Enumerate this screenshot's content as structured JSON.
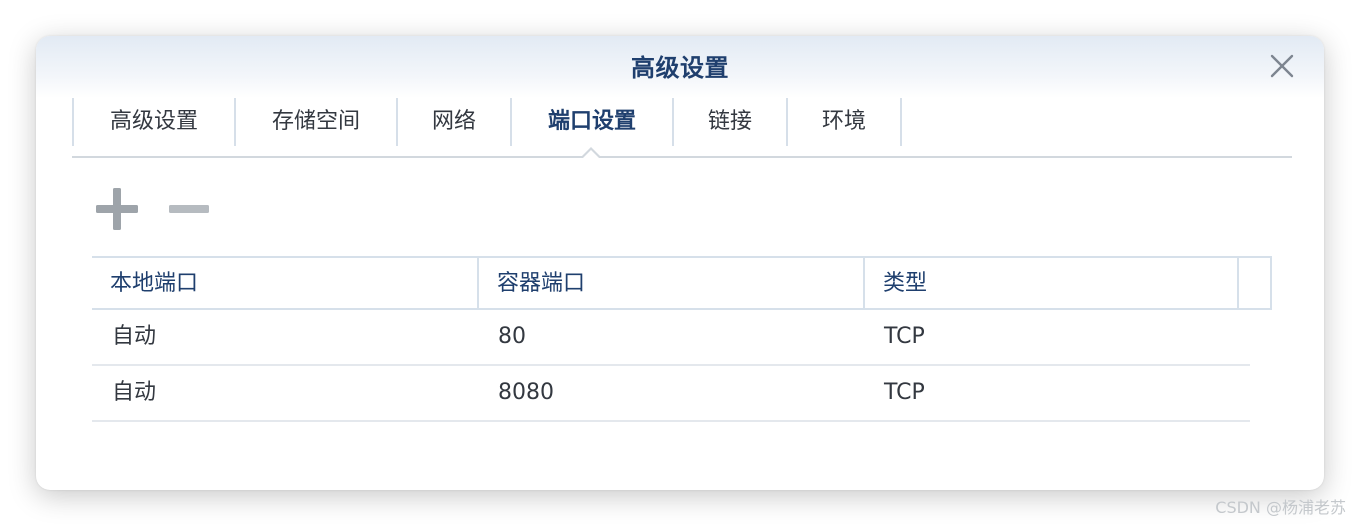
{
  "dialog": {
    "title": "高级设置",
    "close_icon": "close-icon"
  },
  "tabs": [
    {
      "label": "高级设置",
      "active": false
    },
    {
      "label": "存储空间",
      "active": false
    },
    {
      "label": "网络",
      "active": false
    },
    {
      "label": "端口设置",
      "active": true
    },
    {
      "label": "链接",
      "active": false
    },
    {
      "label": "环境",
      "active": false
    }
  ],
  "toolbar": {
    "add_icon": "plus-icon",
    "remove_icon": "minus-icon"
  },
  "table": {
    "columns": [
      "本地端口",
      "容器端口",
      "类型"
    ],
    "rows": [
      [
        "自动",
        "80",
        "TCP"
      ],
      [
        "自动",
        "8080",
        "TCP"
      ]
    ]
  },
  "watermark": "CSDN @杨浦老苏",
  "colors": {
    "title": "#1f3f6e",
    "active_tab": "#1f3f6e",
    "text": "#333840",
    "divider": "#d6e0ea"
  }
}
